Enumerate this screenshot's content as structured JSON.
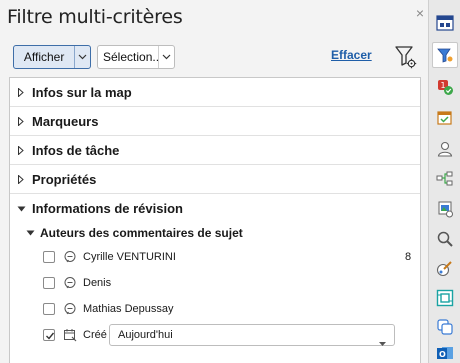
{
  "panel": {
    "title": "Filtre multi-critères",
    "close_symbol": "×"
  },
  "toolbar": {
    "show_label": "Afficher",
    "selection_label": "Sélection...",
    "clear_label": "Effacer"
  },
  "sections": [
    {
      "label": "Infos sur la map",
      "expanded": false
    },
    {
      "label": "Marqueurs",
      "expanded": false
    },
    {
      "label": "Infos de tâche",
      "expanded": false
    },
    {
      "label": "Propriétés",
      "expanded": false
    },
    {
      "label": "Informations de révision",
      "expanded": true
    }
  ],
  "review": {
    "subsection_label": "Auteurs des commentaires de sujet",
    "authors": [
      {
        "name": "Cyrille VENTURINI",
        "count": "8",
        "checked": false
      },
      {
        "name": "Denis",
        "count": "",
        "checked": false
      },
      {
        "name": "Mathias Depussay",
        "count": "",
        "checked": false
      }
    ],
    "created": {
      "label": "Créé",
      "value": "Aujourd'hui",
      "checked": true
    }
  },
  "sidebar_icons": [
    "map-view-icon",
    "filter-icon",
    "markers-icon",
    "task-calendar-icon",
    "resources-icon",
    "relationships-icon",
    "library-icon",
    "search-icon",
    "format-icon",
    "overview-icon",
    "duplicate-icon",
    "outlook-icon"
  ],
  "colors": {
    "accent_link": "#1f5ea8",
    "button_border": "#3e6ea8",
    "active_sidebar": "#3a7bd5"
  }
}
